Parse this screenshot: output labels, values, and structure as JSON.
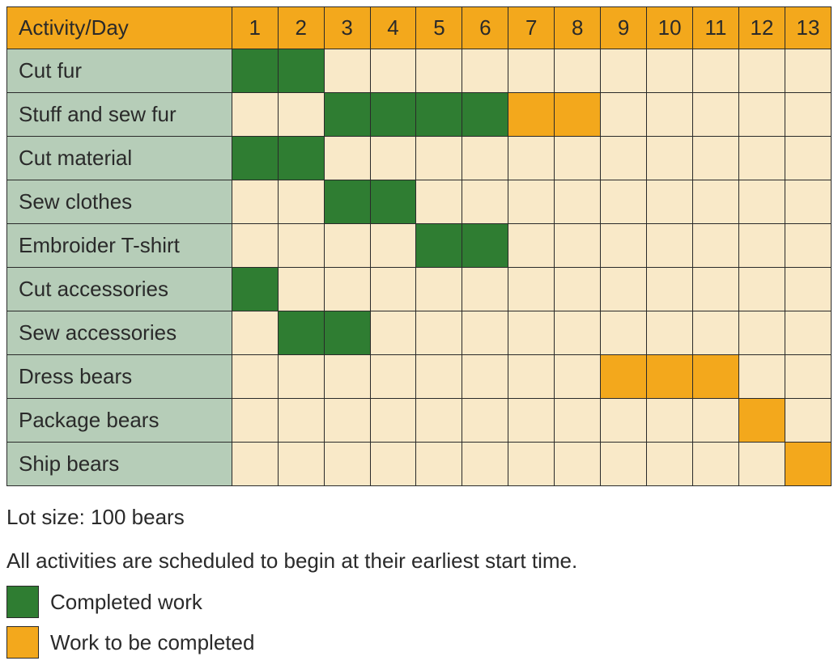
{
  "chart_data": {
    "type": "table",
    "title": "",
    "header_label": "Activity/Day",
    "days": [
      1,
      2,
      3,
      4,
      5,
      6,
      7,
      8,
      9,
      10,
      11,
      12,
      13
    ],
    "activities": [
      {
        "name": "Cut fur",
        "cells": [
          "done",
          "done",
          "",
          "",
          "",
          "",
          "",
          "",
          "",
          "",
          "",
          "",
          ""
        ]
      },
      {
        "name": "Stuff and sew fur",
        "cells": [
          "",
          "",
          "done",
          "done",
          "done",
          "done",
          "todo",
          "todo",
          "",
          "",
          "",
          "",
          ""
        ]
      },
      {
        "name": "Cut material",
        "cells": [
          "done",
          "done",
          "",
          "",
          "",
          "",
          "",
          "",
          "",
          "",
          "",
          "",
          ""
        ]
      },
      {
        "name": "Sew clothes",
        "cells": [
          "",
          "",
          "done",
          "done",
          "",
          "",
          "",
          "",
          "",
          "",
          "",
          "",
          ""
        ]
      },
      {
        "name": "Embroider T-shirt",
        "cells": [
          "",
          "",
          "",
          "",
          "done",
          "done",
          "",
          "",
          "",
          "",
          "",
          "",
          ""
        ]
      },
      {
        "name": "Cut accessories",
        "cells": [
          "done",
          "",
          "",
          "",
          "",
          "",
          "",
          "",
          "",
          "",
          "",
          "",
          ""
        ]
      },
      {
        "name": "Sew accessories",
        "cells": [
          "",
          "done",
          "done",
          "",
          "",
          "",
          "",
          "",
          "",
          "",
          "",
          "",
          ""
        ]
      },
      {
        "name": "Dress bears",
        "cells": [
          "",
          "",
          "",
          "",
          "",
          "",
          "",
          "",
          "todo",
          "todo",
          "todo",
          "",
          ""
        ]
      },
      {
        "name": "Package bears",
        "cells": [
          "",
          "",
          "",
          "",
          "",
          "",
          "",
          "",
          "",
          "",
          "",
          "todo",
          ""
        ]
      },
      {
        "name": "Ship bears",
        "cells": [
          "",
          "",
          "",
          "",
          "",
          "",
          "",
          "",
          "",
          "",
          "",
          "",
          "todo"
        ]
      }
    ],
    "legend": {
      "done": "Completed work",
      "todo": "Work to be completed"
    }
  },
  "notes": {
    "lot_size": "Lot size: 100 bears",
    "schedule_note": "All activities are scheduled to begin at their earliest start time."
  }
}
